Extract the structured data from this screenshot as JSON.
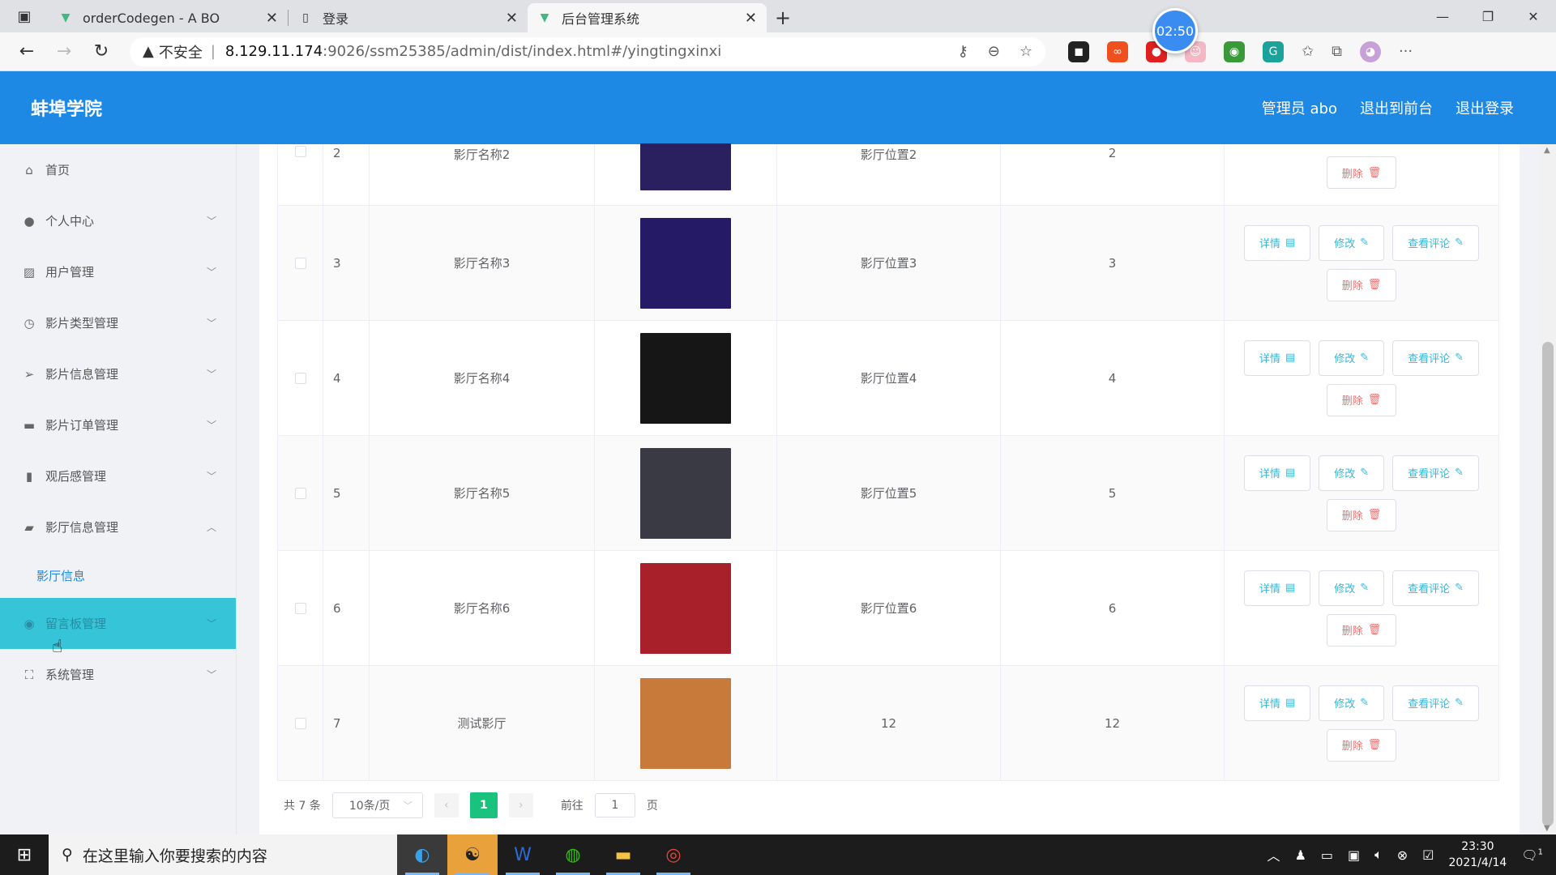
{
  "browser": {
    "tabs": [
      {
        "title": "orderCodegen - A BO",
        "icon": "vue-icon",
        "active": false
      },
      {
        "title": "登录",
        "icon": "page-icon",
        "active": false
      },
      {
        "title": "后台管理系统",
        "icon": "vue-icon",
        "active": true
      }
    ],
    "url": {
      "warning": "不安全",
      "separator": "|",
      "host": "8.129.11.174",
      "path": ":9026/ssm25385/admin/dist/index.html#/yingtingxinxi"
    },
    "timer": "02:50"
  },
  "header": {
    "title": "蚌埠学院",
    "user": "管理员 abo",
    "to_front": "退出到前台",
    "logout": "退出登录"
  },
  "sidebar": {
    "items": [
      {
        "label": "首页",
        "icon": "home-icon",
        "chevron": ""
      },
      {
        "label": "个人中心",
        "icon": "user-icon",
        "chevron": "﹀"
      },
      {
        "label": "用户管理",
        "icon": "chart-icon",
        "chevron": "﹀"
      },
      {
        "label": "影片类型管理",
        "icon": "clock-icon",
        "chevron": "﹀"
      },
      {
        "label": "影片信息管理",
        "icon": "send-icon",
        "chevron": "﹀"
      },
      {
        "label": "影片订单管理",
        "icon": "briefcase-icon",
        "chevron": "﹀"
      },
      {
        "label": "观后感管理",
        "icon": "bar-chart-icon",
        "chevron": "﹀"
      },
      {
        "label": "影厅信息管理",
        "icon": "message-icon",
        "chevron": "︿"
      }
    ],
    "sub_item": "影厅信息",
    "hover_item": {
      "label": "留言板管理",
      "icon": "location-icon",
      "chevron": "﹀"
    },
    "last_item": {
      "label": "系统管理",
      "icon": "fullscreen-icon",
      "chevron": "﹀"
    }
  },
  "table": {
    "rows": [
      {
        "index": "2",
        "name": "影厅名称2",
        "location": "影厅位置2",
        "count": "2",
        "thumb": "#2a2060"
      },
      {
        "index": "3",
        "name": "影厅名称3",
        "location": "影厅位置3",
        "count": "3",
        "thumb": "#241a66"
      },
      {
        "index": "4",
        "name": "影厅名称4",
        "location": "影厅位置4",
        "count": "4",
        "thumb": "#161616"
      },
      {
        "index": "5",
        "name": "影厅名称5",
        "location": "影厅位置5",
        "count": "5",
        "thumb": "#3a3a44"
      },
      {
        "index": "6",
        "name": "影厅名称6",
        "location": "影厅位置6",
        "count": "6",
        "thumb": "#a8202a"
      },
      {
        "index": "7",
        "name": "测试影厅",
        "location": "12",
        "count": "12",
        "thumb": "#c87a3a"
      }
    ],
    "buttons": {
      "detail": "详情",
      "edit": "修改",
      "comments": "查看评论",
      "delete": "删除"
    }
  },
  "pager": {
    "total": "共 7 条",
    "page_size": "10条/页",
    "current": "1",
    "goto_prefix": "前往",
    "goto_value": "1",
    "goto_suffix": "页"
  },
  "taskbar": {
    "search_placeholder": "在这里输入你要搜索的内容",
    "time": "23:30",
    "date": "2021/4/14",
    "notifications": "1"
  }
}
